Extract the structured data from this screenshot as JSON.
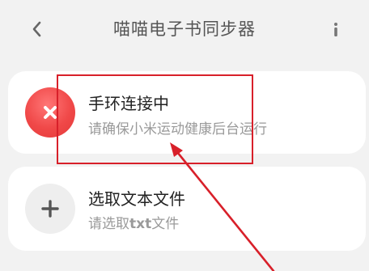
{
  "header": {
    "title": "喵喵电子书同步器",
    "back_icon": "chevron-left-icon",
    "more_icon": "more-vertical-icon"
  },
  "cards": [
    {
      "title": "手环连接中",
      "subtitle": "请确保小米运动健康后台运行",
      "icon": "close-icon",
      "icon_color": "#f04848"
    },
    {
      "title": "选取文本文件",
      "subtitle_prefix": "请选取",
      "subtitle_highlight": "txt",
      "subtitle_suffix": "文件",
      "icon": "plus-icon",
      "icon_color": "#eeeeee"
    }
  ],
  "annotation": {
    "color": "#d8202a"
  }
}
